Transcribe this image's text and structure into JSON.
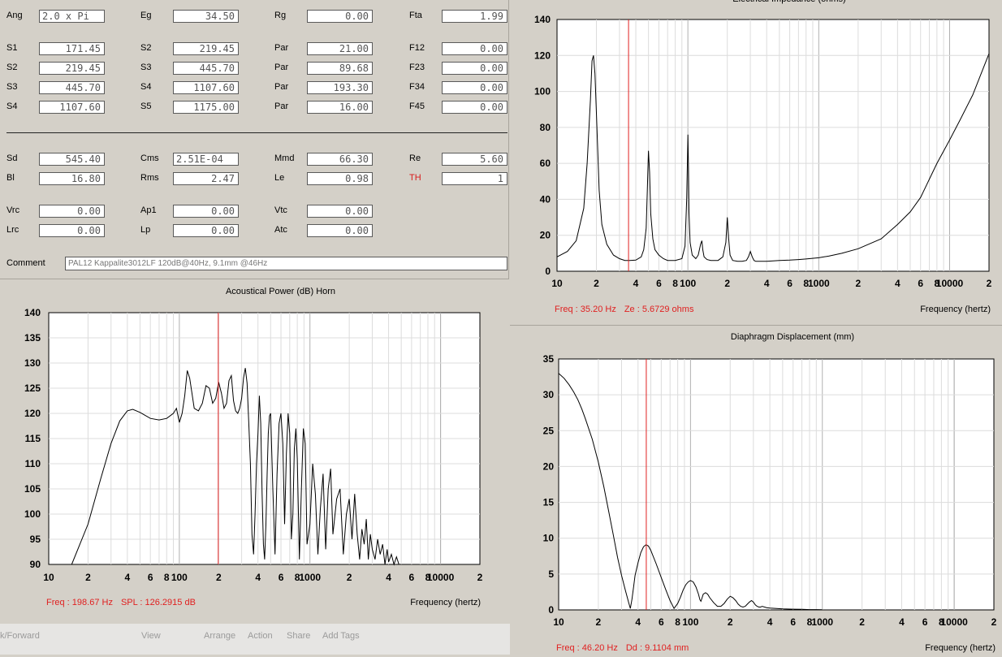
{
  "params": {
    "rows": [
      [
        {
          "label": "Ang",
          "value": "2.0 x Pi",
          "align": "left"
        },
        {
          "label": "Eg",
          "value": "34.50"
        },
        {
          "label": "Rg",
          "value": "0.00"
        },
        {
          "label": "Fta",
          "value": "1.99"
        }
      ],
      [
        {
          "label": "S1",
          "value": "171.45"
        },
        {
          "label": "S2",
          "value": "219.45"
        },
        {
          "label": "Par",
          "value": "21.00"
        },
        {
          "label": "F12",
          "value": "0.00"
        }
      ],
      [
        {
          "label": "S2",
          "value": "219.45"
        },
        {
          "label": "S3",
          "value": "445.70"
        },
        {
          "label": "Par",
          "value": "89.68"
        },
        {
          "label": "F23",
          "value": "0.00"
        }
      ],
      [
        {
          "label": "S3",
          "value": "445.70"
        },
        {
          "label": "S4",
          "value": "1107.60"
        },
        {
          "label": "Par",
          "value": "193.30"
        },
        {
          "label": "F34",
          "value": "0.00"
        }
      ],
      [
        {
          "label": "S4",
          "value": "1107.60"
        },
        {
          "label": "S5",
          "value": "1175.00"
        },
        {
          "label": "Par",
          "value": "16.00"
        },
        {
          "label": "F45",
          "value": "0.00"
        }
      ],
      [
        {
          "label": "Sd",
          "value": "545.40"
        },
        {
          "label": "Cms",
          "value": "2.51E-04",
          "align": "left"
        },
        {
          "label": "Mmd",
          "value": "66.30"
        },
        {
          "label": "Re",
          "value": "5.60"
        }
      ],
      [
        {
          "label": "Bl",
          "value": "16.80"
        },
        {
          "label": "Rms",
          "value": "2.47"
        },
        {
          "label": "Le",
          "value": "0.98"
        },
        {
          "label": "TH",
          "value": "1",
          "labelColor": "red"
        }
      ],
      [
        {
          "label": "Vrc",
          "value": "0.00"
        },
        {
          "label": "Ap1",
          "value": "0.00"
        },
        {
          "label": "Vtc",
          "value": "0.00"
        }
      ],
      [
        {
          "label": "Lrc",
          "value": "0.00"
        },
        {
          "label": "Lp",
          "value": "0.00"
        },
        {
          "label": "Atc",
          "value": "0.00"
        }
      ]
    ],
    "comment_label": "Comment",
    "comment_value": "PAL12 Kappalite3012LF 120dB@40Hz, 9.1mm @46Hz"
  },
  "chart_data": [
    {
      "id": "impedance",
      "type": "line",
      "title": "Electrical Impedance (ohms)",
      "xlabel": "Frequency (hertz)",
      "x_scale": "log",
      "xlim": [
        10,
        20000
      ],
      "ylim": [
        0,
        140
      ],
      "yticks": [
        0,
        20,
        40,
        60,
        80,
        100,
        120,
        140
      ],
      "xtick_labels": [
        [
          10,
          "10"
        ],
        [
          20,
          "2"
        ],
        [
          40,
          "4"
        ],
        [
          60,
          "6"
        ],
        [
          80,
          "8"
        ],
        [
          100,
          "100"
        ],
        [
          200,
          "2"
        ],
        [
          400,
          "4"
        ],
        [
          600,
          "6"
        ],
        [
          800,
          "8"
        ],
        [
          1000,
          "1000"
        ],
        [
          2000,
          "2"
        ],
        [
          4000,
          "4"
        ],
        [
          6000,
          "6"
        ],
        [
          8000,
          "8"
        ],
        [
          10000,
          "10000"
        ],
        [
          20000,
          "2"
        ]
      ],
      "grid": true,
      "cursor_x": 35.2,
      "readout": [
        {
          "label": "Freq",
          "value": "35.20 Hz"
        },
        {
          "label": "Ze",
          "value": "5.6729 ohms"
        }
      ],
      "series": [
        {
          "x": [
            10,
            12,
            14,
            16,
            17,
            18,
            18.5,
            19,
            19.5,
            20,
            21,
            22,
            24,
            27,
            30,
            33,
            36,
            40,
            44,
            46,
            48,
            49,
            50,
            51,
            52,
            54,
            56,
            60,
            65,
            70,
            80,
            90,
            95,
            98,
            100,
            101,
            102,
            104,
            108,
            115,
            120,
            125,
            128,
            130,
            133,
            140,
            150,
            170,
            185,
            195,
            200,
            205,
            210,
            220,
            240,
            260,
            280,
            290,
            300,
            310,
            320,
            330,
            350,
            400,
            500,
            600,
            700,
            800,
            1000,
            1200,
            1500,
            2000,
            3000,
            4000,
            5000,
            6000,
            8000,
            10000,
            12000,
            15000,
            20000
          ],
          "y": [
            8,
            11,
            17,
            35,
            60,
            95,
            117,
            120,
            110,
            88,
            45,
            26,
            15,
            9,
            7,
            6,
            6,
            6.2,
            8,
            12,
            24,
            45,
            67,
            55,
            32,
            18,
            12,
            9,
            7,
            6,
            6,
            7,
            14,
            40,
            76,
            58,
            33,
            16,
            9,
            7,
            9,
            15,
            17,
            12,
            8,
            6.5,
            6,
            6,
            8,
            16,
            30,
            18,
            9,
            6,
            5.5,
            5.5,
            6,
            8,
            11,
            8,
            6,
            5.5,
            5.5,
            5.5,
            6,
            6.2,
            6.5,
            6.8,
            7.5,
            8.5,
            10,
            12.5,
            18,
            26,
            33,
            41,
            60,
            73,
            84,
            98,
            121
          ]
        }
      ]
    },
    {
      "id": "power",
      "type": "line",
      "title": "Acoustical Power (dB)  Horn",
      "xlabel": "Frequency (hertz)",
      "x_scale": "log",
      "xlim": [
        10,
        20000
      ],
      "ylim": [
        90,
        140
      ],
      "yticks": [
        90,
        95,
        100,
        105,
        110,
        115,
        120,
        125,
        130,
        135,
        140
      ],
      "xtick_labels": [
        [
          10,
          "10"
        ],
        [
          20,
          "2"
        ],
        [
          40,
          "4"
        ],
        [
          60,
          "6"
        ],
        [
          80,
          "8"
        ],
        [
          100,
          "100"
        ],
        [
          200,
          "2"
        ],
        [
          400,
          "4"
        ],
        [
          600,
          "6"
        ],
        [
          800,
          "8"
        ],
        [
          1000,
          "1000"
        ],
        [
          2000,
          "2"
        ],
        [
          4000,
          "4"
        ],
        [
          6000,
          "6"
        ],
        [
          8000,
          "8"
        ],
        [
          10000,
          "10000"
        ],
        [
          20000,
          "2"
        ]
      ],
      "grid": true,
      "cursor_x": 198.67,
      "readout": [
        {
          "label": "Freq",
          "value": "198.67 Hz"
        },
        {
          "label": "SPL",
          "value": "126.2915 dB"
        }
      ],
      "series": [
        {
          "x": [
            15,
            20,
            25,
            30,
            35,
            40,
            44,
            50,
            60,
            70,
            80,
            90,
            95,
            100,
            105,
            110,
            115,
            120,
            130,
            140,
            150,
            160,
            170,
            180,
            190,
            200,
            210,
            220,
            230,
            240,
            250,
            260,
            270,
            280,
            290,
            300,
            310,
            320,
            330,
            340,
            350,
            360,
            370,
            380,
            390,
            400,
            410,
            420,
            430,
            440,
            450,
            460,
            470,
            480,
            490,
            500,
            520,
            540,
            560,
            580,
            600,
            620,
            640,
            660,
            680,
            700,
            720,
            740,
            760,
            780,
            800,
            830,
            860,
            890,
            920,
            950,
            1000,
            1050,
            1100,
            1150,
            1200,
            1260,
            1320,
            1380,
            1440,
            1500,
            1600,
            1700,
            1800,
            1900,
            2000,
            2100,
            2200,
            2300,
            2400,
            2500,
            2600,
            2700,
            2800,
            2900,
            3000,
            3150,
            3300,
            3450,
            3600,
            3750,
            3900,
            4000,
            4200,
            4400,
            4600,
            4800,
            5000
          ],
          "y": [
            90,
            98,
            107,
            114,
            118.5,
            120.5,
            120.8,
            120.2,
            119,
            118.7,
            119,
            120,
            121,
            118.2,
            120,
            123.5,
            128.5,
            127,
            121,
            120.5,
            122,
            125.5,
            125,
            122,
            123,
            126.2,
            124,
            121,
            122,
            126.5,
            127.5,
            122.5,
            120.5,
            120,
            121,
            123,
            127,
            129,
            126,
            118,
            110,
            96,
            92,
            100,
            110,
            116,
            123.5,
            118,
            104,
            94,
            91,
            98,
            108,
            116,
            119.5,
            120,
            105,
            92,
            108,
            118,
            120,
            114,
            98,
            112,
            120,
            116,
            95,
            100,
            113,
            117,
            111,
            91,
            105,
            117,
            114,
            94,
            98,
            110,
            104,
            92,
            101,
            108,
            93,
            105,
            109,
            96,
            103,
            105,
            92,
            100,
            103,
            95,
            104,
            96,
            91,
            97,
            94,
            99,
            91,
            96,
            93,
            91,
            95,
            92,
            94,
            90,
            93,
            90.5,
            92,
            90,
            91.5,
            90,
            90
          ]
        }
      ]
    },
    {
      "id": "displacement",
      "type": "line",
      "title": "Diaphragm Displacement (mm)",
      "xlabel": "Frequency (hertz)",
      "x_scale": "log",
      "xlim": [
        10,
        20000
      ],
      "ylim": [
        0,
        35
      ],
      "yticks": [
        0,
        5,
        10,
        15,
        20,
        25,
        30,
        35
      ],
      "xtick_labels": [
        [
          10,
          "10"
        ],
        [
          20,
          "2"
        ],
        [
          40,
          "4"
        ],
        [
          60,
          "6"
        ],
        [
          80,
          "8"
        ],
        [
          100,
          "100"
        ],
        [
          200,
          "2"
        ],
        [
          400,
          "4"
        ],
        [
          600,
          "6"
        ],
        [
          800,
          "8"
        ],
        [
          1000,
          "1000"
        ],
        [
          2000,
          "2"
        ],
        [
          4000,
          "4"
        ],
        [
          6000,
          "6"
        ],
        [
          8000,
          "8"
        ],
        [
          10000,
          "10000"
        ],
        [
          20000,
          "2"
        ]
      ],
      "grid": true,
      "cursor_x": 46.2,
      "readout": [
        {
          "label": "Freq",
          "value": "46.20 Hz"
        },
        {
          "label": "Dd",
          "value": "9.1104 mm"
        }
      ],
      "series": [
        {
          "x": [
            10,
            11,
            12,
            13,
            14,
            15,
            16,
            18,
            20,
            22,
            24,
            26,
            28,
            30,
            32,
            34,
            35,
            36,
            37,
            38,
            40,
            42,
            44,
            46,
            48,
            50,
            55,
            60,
            65,
            70,
            75,
            80,
            84,
            88,
            92,
            96,
            100,
            105,
            110,
            115,
            118,
            120,
            122,
            125,
            130,
            135,
            140,
            150,
            160,
            170,
            180,
            190,
            200,
            210,
            220,
            230,
            240,
            250,
            260,
            270,
            280,
            290,
            300,
            310,
            320,
            330,
            340,
            350,
            380,
            400,
            450,
            500,
            600,
            700,
            800,
            900,
            1000
          ],
          "y": [
            33,
            32.3,
            31.4,
            30.4,
            29.3,
            28,
            26.6,
            23.8,
            20.6,
            17.2,
            13.7,
            10.4,
            7.3,
            4.8,
            2.8,
            1,
            0.2,
            1.5,
            3.2,
            4.8,
            6.6,
            8,
            8.8,
            9.1,
            8.9,
            8.3,
            6.4,
            4.5,
            2.8,
            1.3,
            0.2,
            0.9,
            1.8,
            2.8,
            3.5,
            3.9,
            4.1,
            3.9,
            3.2,
            2.2,
            1.4,
            1.2,
            1.6,
            2.2,
            2.4,
            2.2,
            1.7,
            1,
            0.5,
            0.5,
            0.9,
            1.5,
            1.9,
            1.7,
            1.3,
            0.8,
            0.5,
            0.4,
            0.5,
            0.8,
            1.1,
            1.3,
            1.1,
            0.7,
            0.5,
            0.4,
            0.4,
            0.5,
            0.3,
            0.25,
            0.2,
            0.15,
            0.1,
            0.08,
            0.05,
            0.04,
            0.03
          ]
        }
      ]
    }
  ],
  "footer": {
    "back_forward": "k/Forward",
    "view": "View",
    "arrange": "Arrange",
    "action": "Action",
    "share": "Share",
    "add_tags": "Add Tags"
  }
}
